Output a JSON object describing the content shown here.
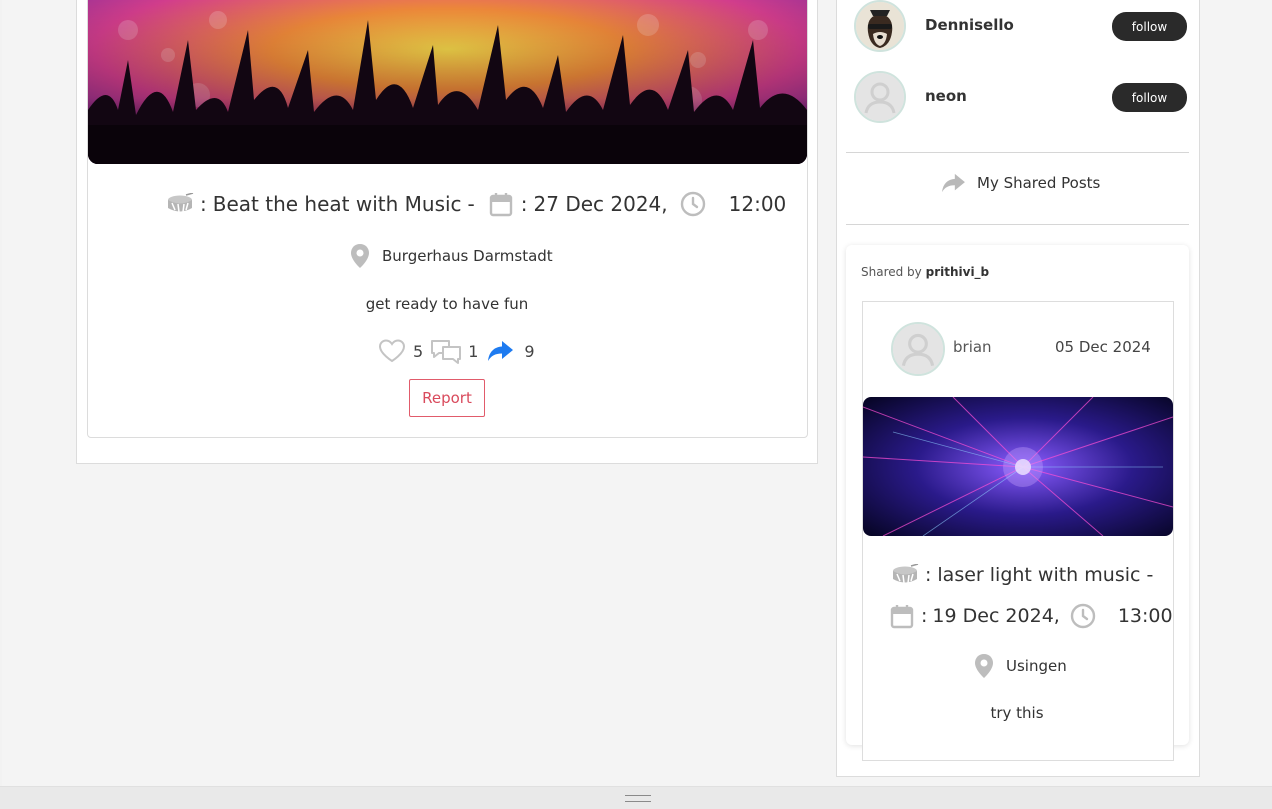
{
  "post": {
    "title": "Beat the heat with Music",
    "date": "27 Dec 2024,",
    "time": "12:00",
    "location": "Burgerhaus Darmstadt",
    "description": "get ready to have fun",
    "likes": "5",
    "comments": "1",
    "shares": "9",
    "report_label": "Report"
  },
  "suggestions": [
    {
      "name": "Dennisello",
      "follow_label": "follow",
      "avatar": "dog-photo"
    },
    {
      "name": "neon",
      "follow_label": "follow",
      "avatar": "default-user-icon"
    }
  ],
  "shared_section": {
    "heading": "My Shared Posts",
    "shared_by_label": "Shared by",
    "shared_by_user": "prithivi_b",
    "post": {
      "author": "brian",
      "posted_date": "05 Dec 2024",
      "title": "laser light with music",
      "date": "19 Dec 2024,",
      "time": "13:00",
      "location": "Usingen",
      "description": "try this"
    }
  },
  "colors": {
    "share_icon": "#1e7bf0",
    "report_border": "#e15b6b",
    "follow_button": "#2a2a2a",
    "icon_gray": "#b9b9b9"
  }
}
